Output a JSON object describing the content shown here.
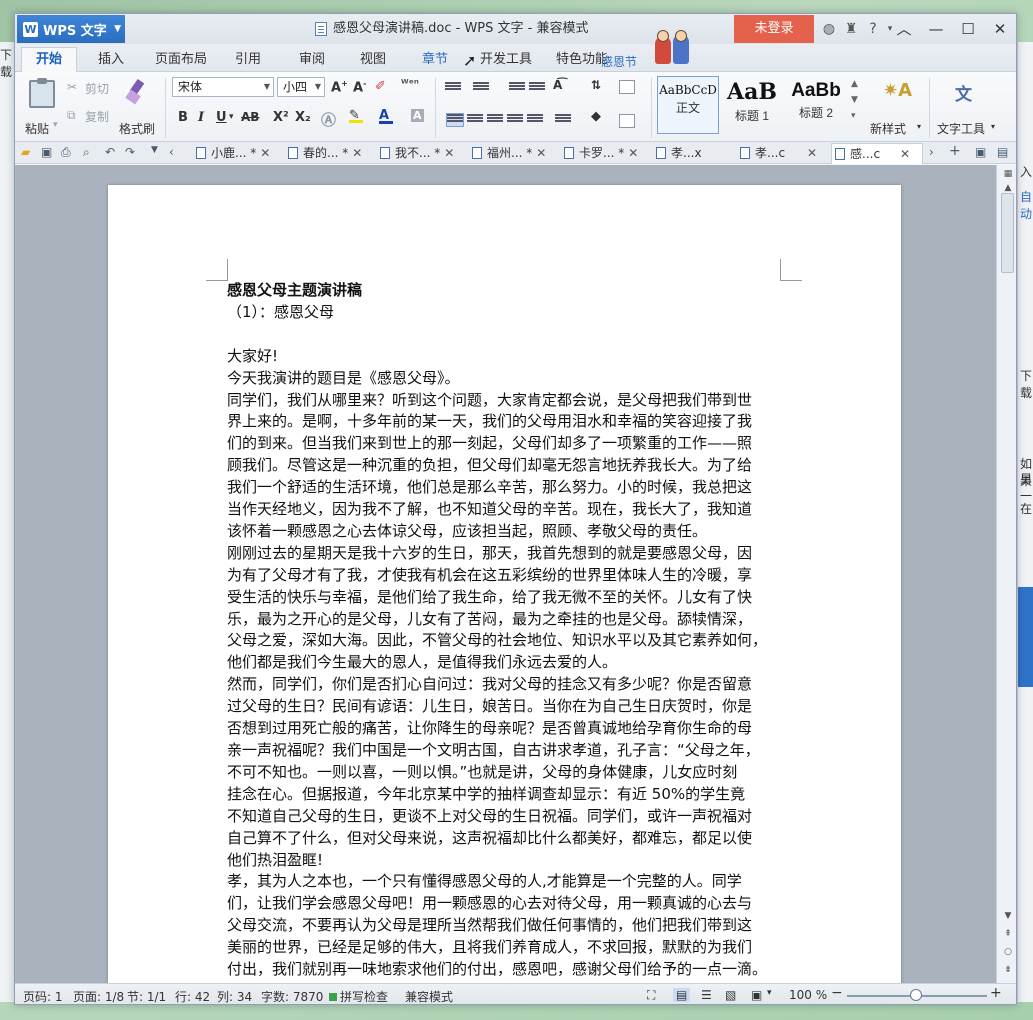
{
  "app": {
    "name": "WPS 文字",
    "window_title": "感恩父母演讲稿.doc - WPS 文字 - 兼容模式",
    "login_label": "未登录"
  },
  "menu_tabs": [
    "开始",
    "插入",
    "页面布局",
    "引用",
    "审阅",
    "视图",
    "章节",
    "开发工具",
    "特色功能"
  ],
  "festival_label": "感恩节",
  "ribbon": {
    "paste": "粘贴",
    "cut": "剪切",
    "copy": "复制",
    "format_painter": "格式刷",
    "font_name": "宋体",
    "font_size": "小四",
    "bold": "B",
    "italic": "I",
    "underline": "U",
    "strike": "AB",
    "superscript": "X²",
    "subscript": "X₂",
    "styles": [
      {
        "sample": "AaBbCcD",
        "caption": "正文"
      },
      {
        "sample": "AaB",
        "caption": "标题 1"
      },
      {
        "sample": "AaBb",
        "caption": "标题 2"
      }
    ],
    "new_style": "新样式",
    "text_tools": "文字工具"
  },
  "doc_tabs": [
    "小鹿... *",
    "春的... *",
    "我不... *",
    "福州... *",
    "卡罗... *",
    "孝...x",
    "孝...c",
    "感...c"
  ],
  "document": {
    "title": "感恩父母主题演讲稿",
    "subtitle": "（1）：感恩父母",
    "lines": [
      "大家好!",
      "今天我演讲的题目是《感恩父母》。",
      "同学们，我们从哪里来？听到这个问题，大家肯定都会说，是父母把我们带到世",
      "界上来的。是啊，十多年前的某一天，我们的父母用泪水和幸福的笑容迎接了我",
      "们的到来。但当我们来到世上的那一刻起，父母们却多了一项繁重的工作——照",
      "顾我们。尽管这是一种沉重的负担，但父母们却毫无怨言地抚养我长大。为了给",
      "我们一个舒适的生活环境，他们总是那么辛苦，那么努力。小的时候，我总把这",
      "当作天经地义，因为我不了解，也不知道父母的辛苦。现在，我长大了，我知道",
      "该怀着一颗感恩之心去体谅父母，应该担当起，照顾、孝敬父母的责任。",
      "刚刚过去的星期天是我十六岁的生日，那天，我首先想到的就是要感恩父母，因",
      "为有了父母才有了我，才使我有机会在这五彩缤纷的世界里体味人生的冷暖，享",
      "受生活的快乐与幸福，是他们给了我生命，给了我无微不至的关怀。儿女有了快",
      "乐，最为之开心的是父母，儿女有了苦闷，最为之牵挂的也是父母。舔犊情深，",
      "父母之爱，深如大海。因此，不管父母的社会地位、知识水平以及其它素养如何，",
      "他们都是我们今生最大的恩人，是值得我们永远去爱的人。",
      "然而，同学们，你们是否扪心自问过：我对父母的挂念又有多少呢？你是否留意",
      "过父母的生日？民间有谚语：儿生日，娘苦日。当你在为自己生日庆贺时，你是",
      "否想到过用死亡般的痛苦，让你降生的母亲呢？是否曾真诚地给孕育你生命的母",
      "亲一声祝福呢？我们中国是一个文明古国，自古讲求孝道，孔子言：“父母之年，",
      "不可不知也。一则以喜，一则以惧。”也就是讲，父母的身体健康，儿女应时刻",
      "挂念在心。但据报道，今年北京某中学的抽样调查却显示：有近 50%的学生竟",
      "不知道自己父母的生日，更谈不上对父母的生日祝福。同学们，或许一声祝福对",
      "自己算不了什么，但对父母来说，这声祝福却比什么都美好，都难忘，都足以使",
      "他们热泪盈眶!",
      "孝，其为人之本也，一个只有懂得感恩父母的人,才能算是一个完整的人。同学",
      "们，让我们学会感恩父母吧！用一颗感恩的心去对待父母，用一颗真诚的心去与",
      "父母交流，不要再认为父母是理所当然帮我们做任何事情的，他们把我们带到这",
      "美丽的世界，已经是足够的伟大，且将我们养育成人，不求回报，默默的为我们",
      "付出，我们就别再一味地索求他们的付出，感恩吧，感谢父母们给予的一点一滴。"
    ]
  },
  "status": {
    "page": "页码: 1",
    "pages": "页面: 1/8",
    "section": "节: 1/1",
    "row": "行: 42",
    "col": "列: 34",
    "word_count": "字数: 7870",
    "spell_check": "拼写检查",
    "compat": "兼容模式",
    "zoom": "100 %"
  },
  "background_fragments": {
    "left": [
      "下载"
    ],
    "right": [
      "入",
      "自动",
      "下载",
      "如果",
      "另一",
      "在"
    ]
  },
  "colors": {
    "accent": "#2a6dbf",
    "login": "#e4614b",
    "doc_bg": "#a9b2bd"
  }
}
